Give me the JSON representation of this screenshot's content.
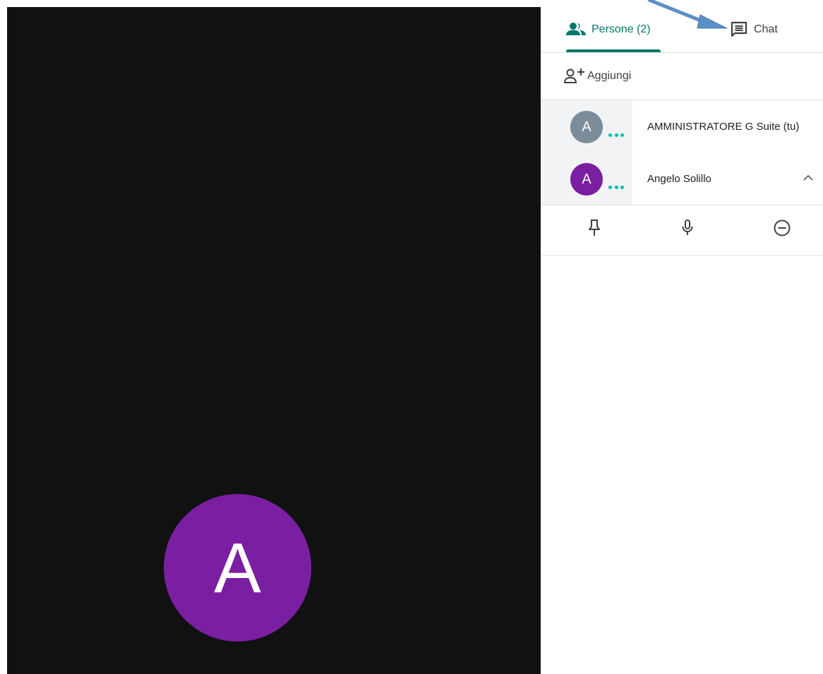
{
  "colors": {
    "accent": "#00796b",
    "video_background": "#111111",
    "purple_avatar": "#7b1fa2",
    "gray_avatar": "#7b8d9b",
    "speaking_dots": "#00bfa5",
    "annotation_arrow": "#5b8fc7"
  },
  "video": {
    "avatar_initial": "A"
  },
  "tabs": {
    "people_label": "Persone (2)",
    "people_icon": "people-icon",
    "chat_label": "Chat",
    "chat_icon": "chat-icon",
    "active": "people"
  },
  "add": {
    "label": "Aggiungi",
    "icon": "add-person-icon"
  },
  "participants": [
    {
      "initial": "A",
      "name": "AMMINISTRATORE G Suite (tu)",
      "avatar_color": "#7b8d9b"
    },
    {
      "initial": "A",
      "name": "Angelo Solillo",
      "avatar_color": "#7b1fa2",
      "expanded": true
    }
  ],
  "participant_actions": [
    {
      "icon": "pin-icon"
    },
    {
      "icon": "microphone-icon"
    },
    {
      "icon": "remove-icon"
    }
  ]
}
